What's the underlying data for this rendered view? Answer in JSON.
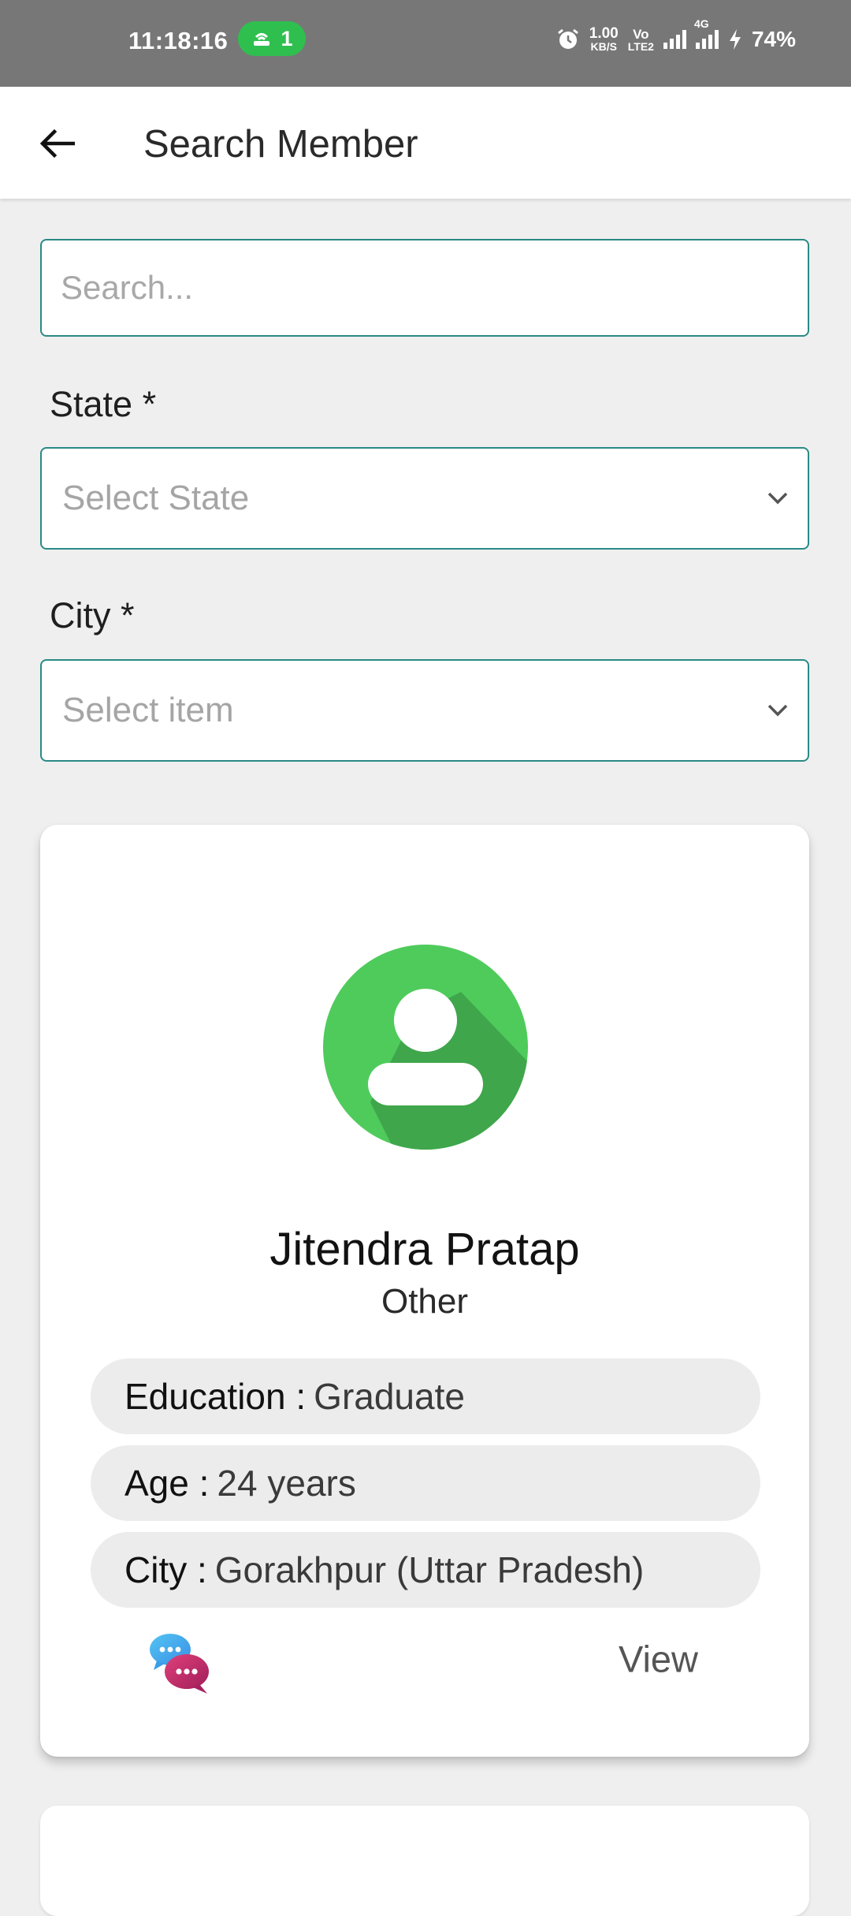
{
  "status_bar": {
    "time": "11:18:16",
    "hotspot_count": "1",
    "net_speed_top": "1.00",
    "net_speed_bottom": "KB/S",
    "volte_top": "Vo",
    "volte_bottom": "LTE2",
    "network_type": "4G",
    "battery": "74%"
  },
  "app_bar": {
    "title": "Search Member"
  },
  "search": {
    "placeholder": "Search..."
  },
  "state_field": {
    "label": "State *",
    "placeholder": "Select State"
  },
  "city_field": {
    "label": "City *",
    "placeholder": "Select item"
  },
  "member_card": {
    "name": "Jitendra Pratap",
    "gender": "Other",
    "education_label": "Education :",
    "education_value": "Graduate",
    "age_label": "Age :",
    "age_value": "24 years",
    "city_label": "City :",
    "city_value": "Gorakhpur (Uttar Pradesh)",
    "view_label": "View"
  },
  "colors": {
    "accent_border": "#2a8a86",
    "avatar_green": "#4fcb5c",
    "status_bar": "#777777"
  },
  "icons": [
    "back-arrow-icon",
    "chevron-down-icon",
    "avatar-icon",
    "chat-icon",
    "alarm-icon",
    "hotspot-icon",
    "signal-icon",
    "charging-icon"
  ]
}
